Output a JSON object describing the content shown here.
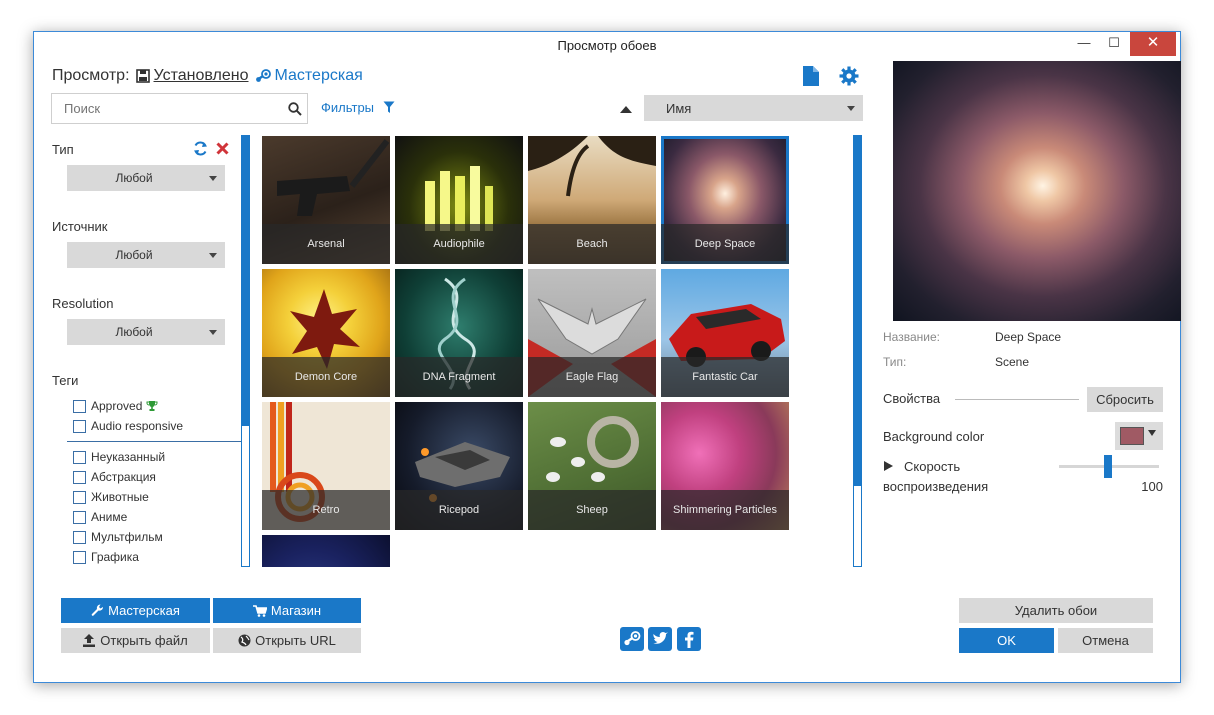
{
  "window": {
    "title": "Просмотр обоев",
    "minimize": "—",
    "maximize": "☐",
    "close": "✕"
  },
  "header": {
    "view_label": "Просмотр:",
    "tab_installed": "Установлено",
    "tab_workshop": "Мастерская"
  },
  "search": {
    "placeholder": "Поиск",
    "filters_label": "Фильтры"
  },
  "sort": {
    "selected": "Имя"
  },
  "filters": {
    "type_label": "Тип",
    "type_value": "Любой",
    "source_label": "Источник",
    "source_value": "Любой",
    "resolution_label": "Resolution",
    "resolution_value": "Любой",
    "tags_label": "Теги",
    "tags_top": [
      "Approved",
      "Audio responsive"
    ],
    "tags": [
      "Неуказанный",
      "Абстракция",
      "Животные",
      "Аниме",
      "Мультфильм",
      "Графика"
    ]
  },
  "wallpapers": [
    "Arsenal",
    "Audiophile",
    "Beach",
    "Deep Space",
    "Demon Core",
    "DNA Fragment",
    "Eagle Flag",
    "Fantastic Car",
    "Retro",
    "Ricepod",
    "Sheep",
    "Shimmering Particles"
  ],
  "details": {
    "name_label": "Название:",
    "name_value": "Deep Space",
    "type_label": "Тип:",
    "type_value": "Scene",
    "props_label": "Свойства",
    "reset_label": "Сбросить",
    "bg_color_label": "Background color",
    "bg_color": "#a05a64",
    "speed_label_1": "Скорость",
    "speed_label_2": "воспроизведения",
    "speed_value": "100",
    "speed_fraction": 0.49
  },
  "bottom": {
    "workshop_btn": "Мастерская",
    "store_btn": "Магазин",
    "open_file_btn": "Открыть файл",
    "open_url_btn": "Открыть URL",
    "delete_btn": "Удалить обои",
    "ok_btn": "OK",
    "cancel_btn": "Отмена"
  },
  "colors": {
    "accent": "#1a78c8",
    "close_red": "#c9463d"
  }
}
